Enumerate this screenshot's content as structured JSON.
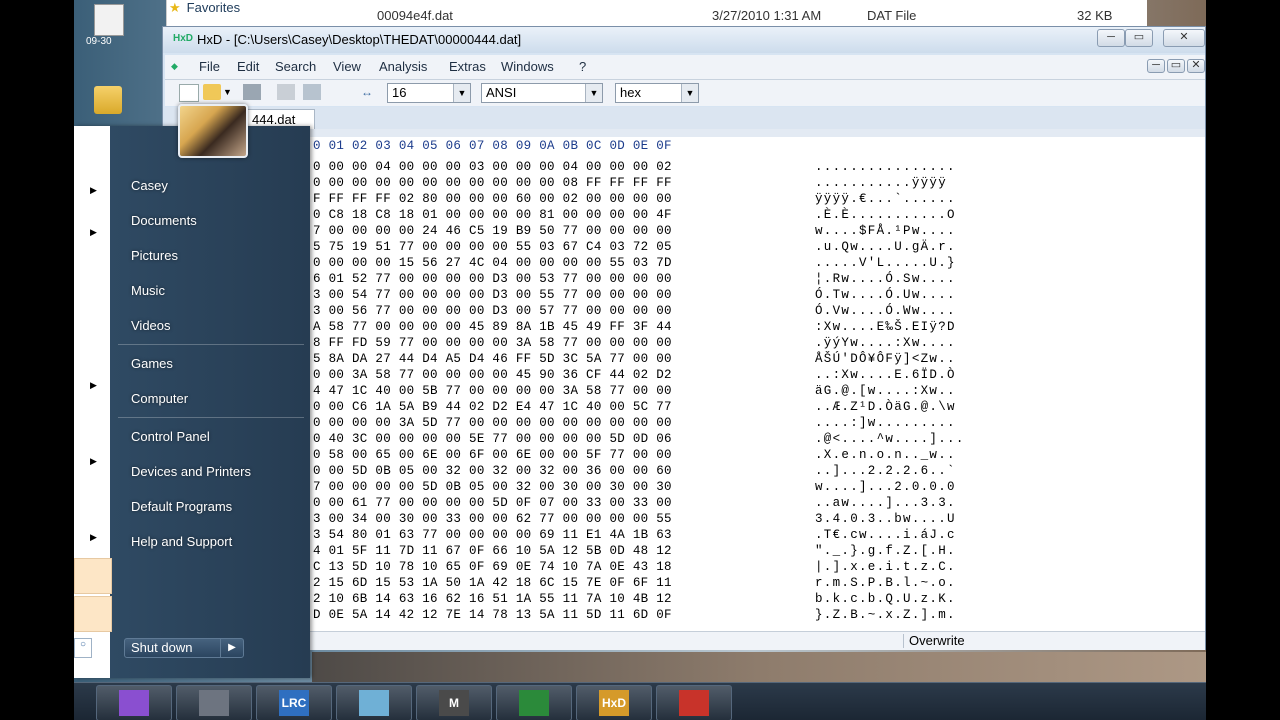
{
  "desktop": {
    "icon_label": "09-30"
  },
  "explorer": {
    "favorites_label": "Favorites",
    "file_name": "00094e4f.dat",
    "date_modified": "3/27/2010 1:31 AM",
    "type": "DAT File",
    "size": "32 KB"
  },
  "hxd": {
    "title": "HxD - [C:\\Users\\Casey\\Desktop\\THEDAT\\00000444.dat]",
    "menu": [
      "File",
      "Edit",
      "Search",
      "View",
      "Analysis",
      "Extras",
      "Windows",
      "?"
    ],
    "bytes_per_row": "16",
    "charset": "ANSI",
    "offset_base": "hex",
    "tab_label": "444.dat",
    "header_row": "0 01 02 03 04 05 06 07 08 09 0A 0B 0C 0D 0E 0F",
    "rows": [
      {
        "hex": "0 00 00 04 00 00 00 03 00 00 00 04 00 00 00 02",
        "text": "................"
      },
      {
        "hex": "0 00 00 00 00 00 00 00 00 00 00 08 FF FF FF FF",
        "text": "...........ÿÿÿÿ"
      },
      {
        "hex": "F FF FF FF 02 80 00 00 00 60 00 02 00 00 00 00",
        "text": "ÿÿÿÿ.€...`......"
      },
      {
        "hex": "0 C8 18 C8 18 01 00 00 00 00 81 00 00 00 00 4F",
        "text": ".È.È...........O"
      },
      {
        "hex": "7 00 00 00 00 24 46 C5 19 B9 50 77 00 00 00 00",
        "text": "w....$FÅ.¹Pw...."
      },
      {
        "hex": "5 75 19 51 77 00 00 00 00 55 03 67 C4 03 72 05",
        "text": ".u.Qw....U.gÄ.r."
      },
      {
        "hex": "0 00 00 00 15 56 27 4C 04 00 00 00 00 55 03 7D",
        "text": ".....V'L.....U.}"
      },
      {
        "hex": "6 01 52 77 00 00 00 00 D3 00 53 77 00 00 00 00",
        "text": "¦.Rw....Ó.Sw...."
      },
      {
        "hex": "3 00 54 77 00 00 00 00 D3 00 55 77 00 00 00 00",
        "text": "Ó.Tw....Ó.Uw...."
      },
      {
        "hex": "3 00 56 77 00 00 00 00 D3 00 57 77 00 00 00 00",
        "text": "Ó.Vw....Ó.Ww...."
      },
      {
        "hex": "A 58 77 00 00 00 00 45 89 8A 1B 45 49 FF 3F 44",
        "text": ":Xw....E‰Š.EIÿ?D"
      },
      {
        "hex": "8 FF FD 59 77 00 00 00 00 3A 58 77 00 00 00 00",
        "text": ".ÿýYw....:Xw...."
      },
      {
        "hex": "5 8A DA 27 44 D4 A5 D4 46 FF 5D 3C 5A 77 00 00",
        "text": "ÅŠÚ'DÔ¥ÔFÿ]<Zw.."
      },
      {
        "hex": "0 00 3A 58 77 00 00 00 00 45 90 36 CF 44 02 D2",
        "text": "..:Xw....E.6ÏD.Ò"
      },
      {
        "hex": "4 47 1C 40 00 5B 77 00 00 00 00 3A 58 77 00 00",
        "text": "äG.@.[w....:Xw.."
      },
      {
        "hex": "0 00 C6 1A 5A B9 44 02 D2 E4 47 1C 40 00 5C 77",
        "text": "..Æ.Z¹D.ÒäG.@.\\w"
      },
      {
        "hex": "0 00 00 00 3A 5D 77 00 00 00 00 00 00 00 00 00",
        "text": "....:]w........."
      },
      {
        "hex": "0 40 3C 00 00 00 00 5E 77 00 00 00 00 5D 0D 06",
        "text": ".@<....^w....]..."
      },
      {
        "hex": "0 58 00 65 00 6E 00 6F 00 6E 00 00 5F 77 00 00",
        "text": ".X.e.n.o.n.._w.."
      },
      {
        "hex": "0 00 5D 0B 05 00 32 00 32 00 32 00 36 00 00 60",
        "text": "..]...2.2.2.6..`"
      },
      {
        "hex": "7 00 00 00 00 5D 0B 05 00 32 00 30 00 30 00 30",
        "text": "w....]...2.0.0.0"
      },
      {
        "hex": "0 00 61 77 00 00 00 00 5D 0F 07 00 33 00 33 00",
        "text": "..aw....]...3.3."
      },
      {
        "hex": "3 00 34 00 30 00 33 00 00 62 77 00 00 00 00 55",
        "text": "3.4.0.3..bw....U"
      },
      {
        "hex": "3 54 80 01 63 77 00 00 00 00 69 11 E1 4A 1B 63",
        "text": ".T€.cw....i.áJ.c"
      },
      {
        "hex": "4 01 5F 11 7D 11 67 0F 66 10 5A 12 5B 0D 48 12",
        "text": "\"._.}.g.f.Z.[.H."
      },
      {
        "hex": "C 13 5D 10 78 10 65 0F 69 0E 74 10 7A 0E 43 18",
        "text": "|.].x.e.i.t.z.C."
      },
      {
        "hex": "2 15 6D 15 53 1A 50 1A 42 18 6C 15 7E 0F 6F 11",
        "text": "r.m.S.P.B.l.~.o."
      },
      {
        "hex": "2 10 6B 14 63 16 62 16 51 1A 55 11 7A 10 4B 12",
        "text": "b.k.c.b.Q.U.z.K."
      },
      {
        "hex": "D 0E 5A 14 42 12 7E 14 78 13 5A 11 5D 11 6D 0F",
        "text": "}.Z.B.~.x.Z.].m."
      }
    ],
    "status_mode": "Overwrite"
  },
  "start_menu": {
    "items": [
      "Casey",
      "Documents",
      "Pictures",
      "Music",
      "Videos",
      "Games",
      "Computer",
      "Control Panel",
      "Devices and Printers",
      "Default Programs",
      "Help and Support"
    ],
    "shutdown_label": "Shut down",
    "arrow": "▶"
  },
  "taskbar": {
    "buttons": [
      {
        "icon": "media-center-icon",
        "label": ""
      },
      {
        "icon": "gear-icon",
        "label": ""
      },
      {
        "icon": "lrc-icon",
        "label": "LRC"
      },
      {
        "icon": "notepad-icon",
        "label": ""
      },
      {
        "icon": "m-app-icon",
        "label": "M"
      },
      {
        "icon": "xbox-icon",
        "label": ""
      },
      {
        "icon": "hxd-icon",
        "label": "HxD"
      },
      {
        "icon": "paint-icon",
        "label": ""
      }
    ]
  }
}
